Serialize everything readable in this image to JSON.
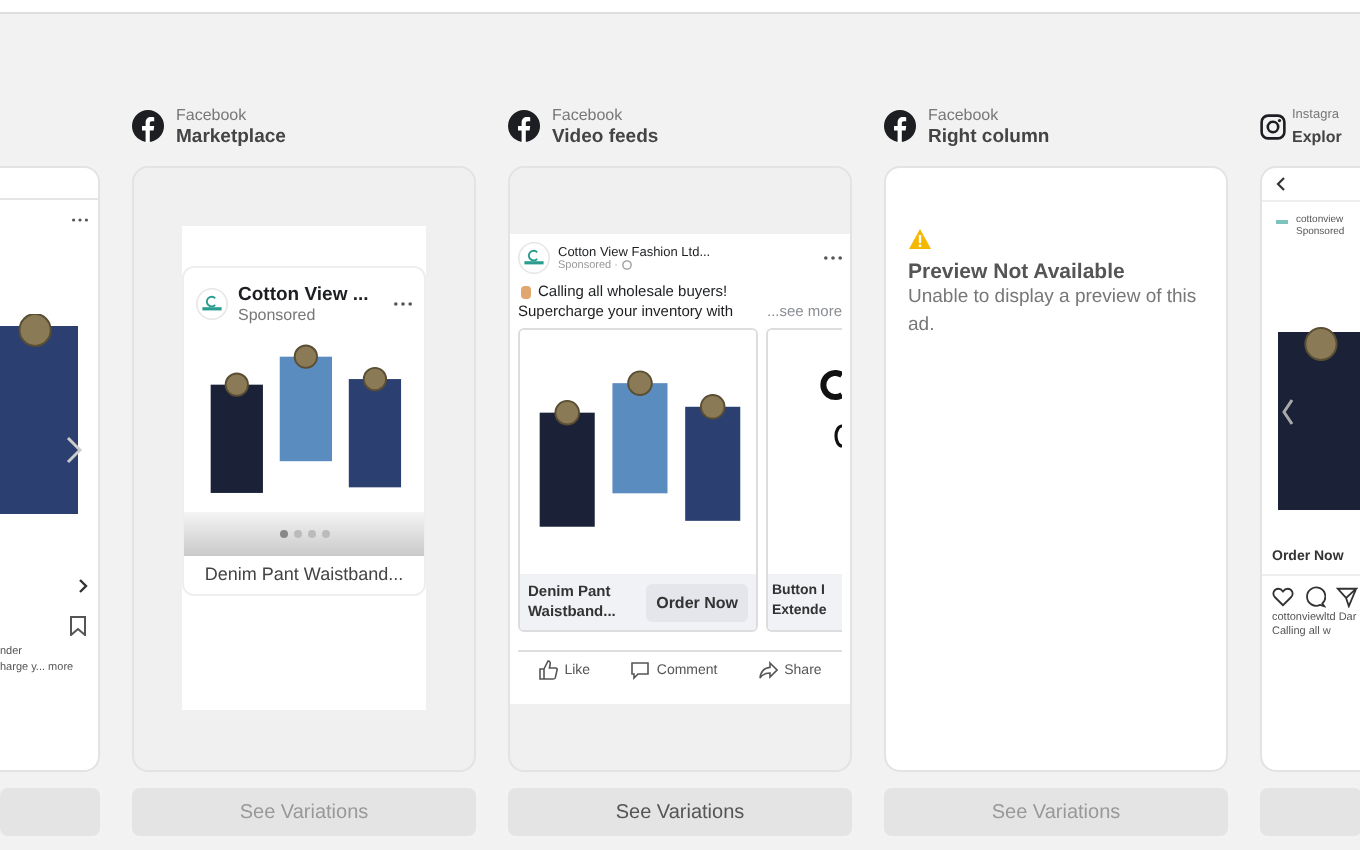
{
  "columns": [
    {
      "kind": "cut_feed",
      "caption_lines": [
        "nder",
        "harge y... more"
      ]
    },
    {
      "kind": "marketplace",
      "platform": "Facebook",
      "placement": "Marketplace",
      "post": {
        "page_name": "Cotton View ...",
        "sponsored": "Sponsored",
        "caption": "Denim Pant Waistband..."
      },
      "button": "See Variations"
    },
    {
      "kind": "video_feeds",
      "platform": "Facebook",
      "placement": "Video feeds",
      "post": {
        "page_name": "Cotton View Fashion Ltd...",
        "sponsored": "Sponsored ·",
        "message": "Calling all wholesale buyers!",
        "message_line_2": "Supercharge your inventory with",
        "see_more": "...see more",
        "cards": [
          {
            "title_lines": [
              "Denim Pant",
              "Waistband..."
            ],
            "cta": "Order Now"
          },
          {
            "title_lines": [
              "Button I",
              "Extende"
            ]
          }
        ],
        "actions": [
          "Like",
          "Comment",
          "Share"
        ]
      },
      "button": "See Variations"
    },
    {
      "kind": "unavailable",
      "platform": "Facebook",
      "placement": "Right column",
      "notice": {
        "title": "Preview Not Available",
        "text": "Unable to display a preview of this ad."
      },
      "button": "See Variations"
    },
    {
      "kind": "instagram_cut",
      "platform": "Instagra",
      "placement": "Explor",
      "post": {
        "page_name": "cottonview",
        "sponsored": "Sponsored",
        "cta": "Order Now",
        "caption": "cottonviewltd Dar",
        "message": "Calling all w"
      }
    }
  ]
}
